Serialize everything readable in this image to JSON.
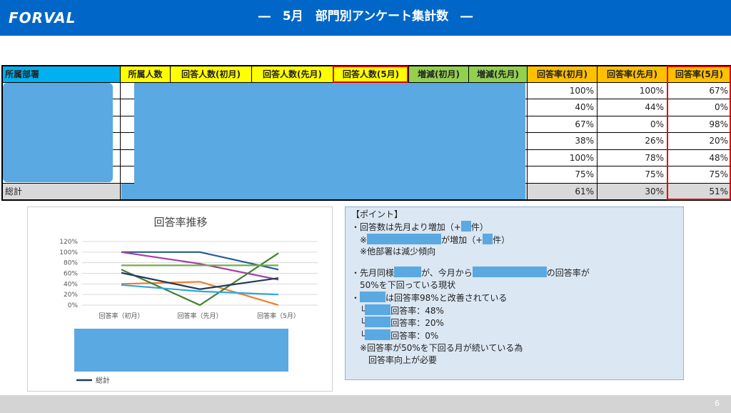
{
  "header": {
    "logo": "FORVAL",
    "title": "―　5月　部門別アンケート集計数　―"
  },
  "table": {
    "headers": [
      "所属部署",
      "所属人数",
      "回答人数(初月)",
      "回答人数(先月)",
      "回答人数(5月)",
      "増減(初月)",
      "増減(先月)",
      "回答率(初月)",
      "回答率(先月)",
      "回答率(5月)"
    ],
    "rows": [
      [
        "100%",
        "100%",
        "67%"
      ],
      [
        "40%",
        "44%",
        "0%"
      ],
      [
        "67%",
        "0%",
        "98%"
      ],
      [
        "38%",
        "26%",
        "20%"
      ],
      [
        "100%",
        "78%",
        "48%"
      ],
      [
        "75%",
        "75%",
        "75%"
      ]
    ],
    "total": {
      "label": "総計",
      "values": [
        "61%",
        "30%",
        "51%"
      ]
    }
  },
  "chart_data": {
    "type": "line",
    "title": "回答率推移",
    "categories": [
      "回答率（初月）",
      "回答率（先月）",
      "回答率（5月）"
    ],
    "yticks": [
      "120%",
      "100%",
      "80%",
      "60%",
      "40%",
      "20%",
      "0%"
    ],
    "ylim": [
      0,
      120
    ],
    "series": [
      {
        "values": [
          100,
          100,
          67
        ],
        "color": "#255e91"
      },
      {
        "values": [
          40,
          44,
          0
        ],
        "color": "#ed7d31"
      },
      {
        "values": [
          67,
          0,
          98
        ],
        "color": "#43802e"
      },
      {
        "values": [
          38,
          26,
          20
        ],
        "color": "#2ea6df"
      },
      {
        "values": [
          100,
          78,
          48
        ],
        "color": "#a33ca6"
      },
      {
        "values": [
          75,
          75,
          75
        ],
        "color": "#70ad47"
      },
      {
        "name": "総計",
        "values": [
          61,
          30,
          51
        ],
        "color": "#1f3b57"
      }
    ],
    "legend": "bottom",
    "grid": true
  },
  "points": {
    "title": "【ポイント】",
    "b1": "・回答数は先月より増加（+",
    "b1_end": "件）",
    "b1_sub_pre": "※",
    "b1_sub": "が増加（+",
    "b1_sub_end": "件）",
    "b1_sub2": "※他部署は減少傾向",
    "b2_pre": "・先月同様",
    "b2_mid": "が、今月から",
    "b2_end": "の回答率が",
    "b2_line2": "50%を下回っている現状",
    "b3_pre": "・",
    "b3": "は回答率98%と改善されている",
    "s1_pre": "└",
    "s1": "回答率：48%",
    "s2_pre": "└",
    "s2": "回答率：20%",
    "s3_pre": "└",
    "s3": "回答率：0%",
    "note1": "※回答率が50%を下回る月が続いている為",
    "note2": "回答率向上が必要"
  },
  "footer": {
    "page": "6"
  }
}
